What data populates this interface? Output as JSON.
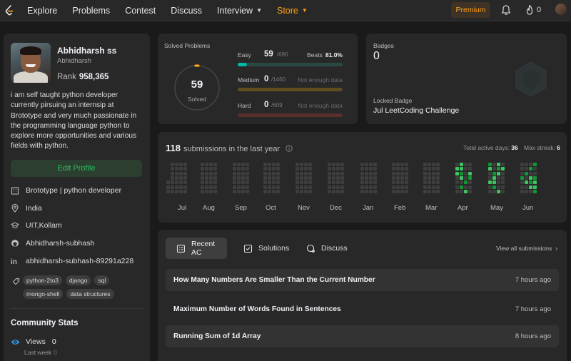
{
  "nav": {
    "items": [
      {
        "label": "Explore",
        "dropdown": false
      },
      {
        "label": "Problems",
        "dropdown": false
      },
      {
        "label": "Contest",
        "dropdown": false
      },
      {
        "label": "Discuss",
        "dropdown": false
      },
      {
        "label": "Interview",
        "dropdown": true
      },
      {
        "label": "Store",
        "dropdown": true
      }
    ],
    "premium_label": "Premium",
    "streak_count": "0",
    "accent_color": "#ffa116"
  },
  "profile": {
    "name": "Abhidharsh ss",
    "username": "Abhidharsh",
    "rank_label": "Rank",
    "rank_value": "958,365",
    "bio": "i am self taught python developer currently pirsuing an internsip at Brototype and very much passionate in the programming language python to explore more opportunities and various fields with python.",
    "edit_label": "Edit Profile",
    "details": [
      {
        "icon": "building-icon",
        "text": "Brototype | python developer"
      },
      {
        "icon": "location-icon",
        "text": "India"
      },
      {
        "icon": "graduation-cap-icon",
        "text": "UIT,Kollam"
      },
      {
        "icon": "github-icon",
        "text": "Abhidharsh-subhash"
      },
      {
        "icon": "linkedin-icon",
        "text": "abhidharsh-subhash-89291a228"
      }
    ],
    "tags": [
      "python-2to3",
      "django",
      "sql",
      "mongo-shell",
      "data structures"
    ]
  },
  "community": {
    "title": "Community Stats",
    "views_label": "Views",
    "views_value": "0",
    "last_week_label": "Last week",
    "last_week_value": "0"
  },
  "solved": {
    "label": "Solved Problems",
    "total": "59",
    "total_label": "Solved",
    "easy": {
      "name": "Easy",
      "solved": "59",
      "total": "/690",
      "beats_label": "Beats",
      "beats_value": "81.0%",
      "fraction": 0.0855
    },
    "medium": {
      "name": "Medium",
      "solved": "0",
      "total": "/1460",
      "note": "Not enough data",
      "fraction": 0
    },
    "hard": {
      "name": "Hard",
      "solved": "0",
      "total": "/609",
      "note": "Not enough data",
      "fraction": 0
    },
    "colors": {
      "easy": "#00b8a3",
      "medium": "#ffc01e",
      "hard": "#ef4743"
    }
  },
  "badges": {
    "label": "Badges",
    "count": "0",
    "locked_label": "Locked Badge",
    "locked_name": "Jul LeetCoding Challenge"
  },
  "submissions": {
    "count": "118",
    "label": "submissions in the last year",
    "active_days_label": "Total active days:",
    "active_days": "36",
    "max_streak_label": "Max streak:",
    "max_streak": "6",
    "months": [
      "Jul",
      "Aug",
      "Sep",
      "Oct",
      "Nov",
      "Dec",
      "Jan",
      "Feb",
      "Mar",
      "Apr",
      "May",
      "Jun"
    ]
  },
  "recent": {
    "tabs": [
      {
        "icon": "recent-ac-icon",
        "label": "Recent AC"
      },
      {
        "icon": "solutions-icon",
        "label": "Solutions"
      },
      {
        "icon": "discuss-icon",
        "label": "Discuss"
      }
    ],
    "view_all": "View all submissions",
    "items": [
      {
        "title": "How Many Numbers Are Smaller Than the Current Number",
        "time": "7 hours ago"
      },
      {
        "title": "Maximum Number of Words Found in Sentences",
        "time": "7 hours ago"
      },
      {
        "title": "Running Sum of 1d Array",
        "time": "8 hours ago"
      }
    ]
  }
}
